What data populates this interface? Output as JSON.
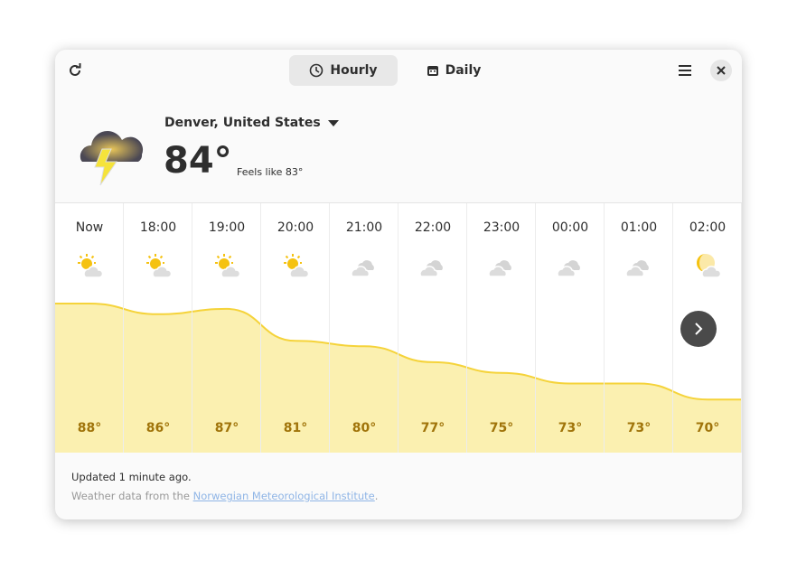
{
  "header": {
    "refresh_icon": "refresh-icon",
    "tabs": [
      {
        "label": "Hourly",
        "icon": "clock-icon",
        "active": true
      },
      {
        "label": "Daily",
        "icon": "calendar-icon",
        "active": false
      }
    ],
    "menu_icon": "hamburger-icon",
    "close_icon": "close-icon"
  },
  "current": {
    "condition_icon": "thunderstorm-icon",
    "location": "Denver, United States",
    "temperature": "84°",
    "feels_like": "Feels like 83°"
  },
  "hourly": [
    {
      "time": "Now",
      "icon": "sun-cloud",
      "temp": "88°",
      "value": 88
    },
    {
      "time": "18:00",
      "icon": "sun-cloud",
      "temp": "86°",
      "value": 86
    },
    {
      "time": "19:00",
      "icon": "sun-cloud",
      "temp": "87°",
      "value": 87
    },
    {
      "time": "20:00",
      "icon": "sun-cloud",
      "temp": "81°",
      "value": 81
    },
    {
      "time": "21:00",
      "icon": "cloud",
      "temp": "80°",
      "value": 80
    },
    {
      "time": "22:00",
      "icon": "cloud",
      "temp": "77°",
      "value": 77
    },
    {
      "time": "23:00",
      "icon": "cloud",
      "temp": "75°",
      "value": 75
    },
    {
      "time": "00:00",
      "icon": "cloud",
      "temp": "73°",
      "value": 73
    },
    {
      "time": "01:00",
      "icon": "cloud",
      "temp": "73°",
      "value": 73
    },
    {
      "time": "02:00",
      "icon": "moon-cloud",
      "temp": "70°",
      "value": 70
    }
  ],
  "colors": {
    "fill": "#fbf0b0",
    "line": "#f5d33a",
    "temp_text": "#a0740a"
  },
  "footer": {
    "updated": "Updated 1 minute ago.",
    "source_prefix": "Weather data from the ",
    "source_link": "Norwegian Meteorological Institute",
    "source_suffix": "."
  }
}
